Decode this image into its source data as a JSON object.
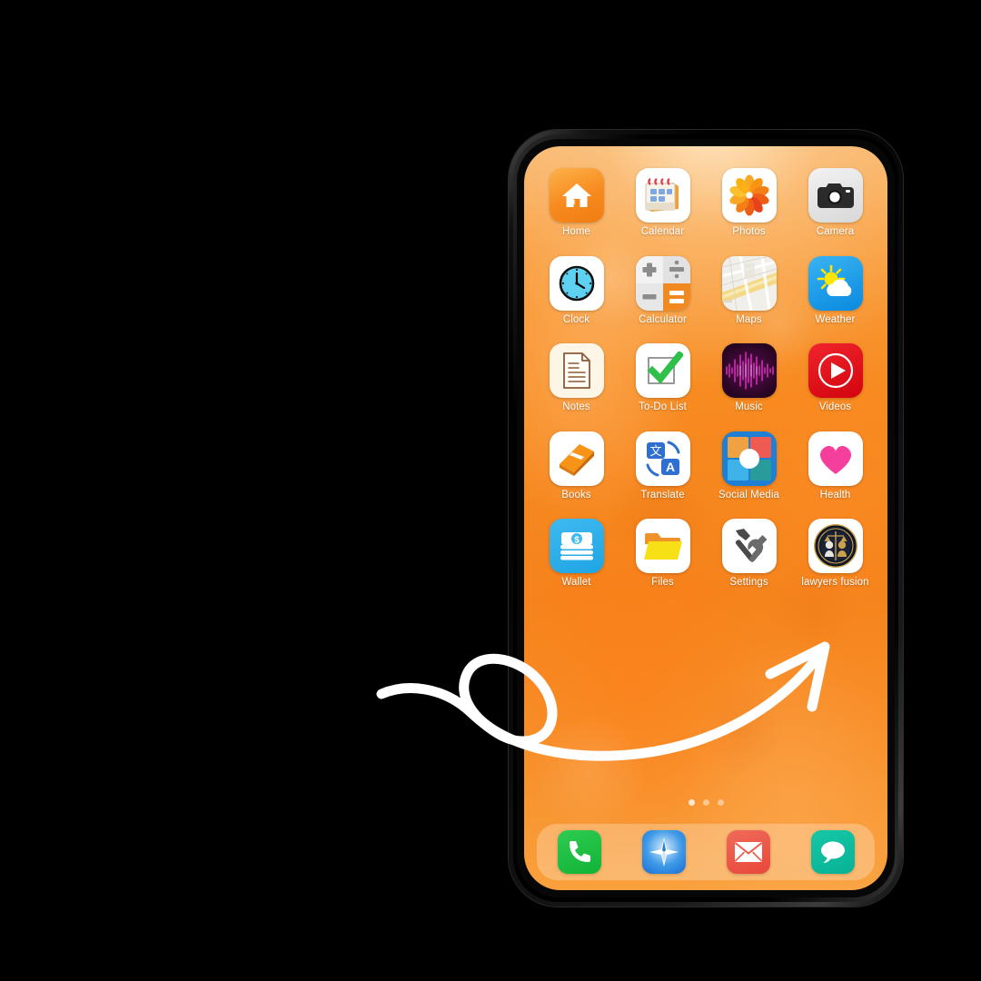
{
  "scene": {
    "background_color": "#000000",
    "device": "smartphone",
    "wallpaper_style": "orange watercolor",
    "wallpaper_colors": [
      "#f9b870",
      "#f78a20",
      "#f6831c"
    ]
  },
  "annotation": {
    "type": "hand-drawn-curved-arrow-with-loop",
    "color": "#ffffff",
    "points_to": "lawyers fusion"
  },
  "homescreen": {
    "apps": [
      {
        "label": "Home",
        "icon": "house-icon"
      },
      {
        "label": "Calendar",
        "icon": "calendar-icon"
      },
      {
        "label": "Photos",
        "icon": "photos-flower-icon"
      },
      {
        "label": "Camera",
        "icon": "camera-icon"
      },
      {
        "label": "Clock",
        "icon": "clock-icon"
      },
      {
        "label": "Calculator",
        "icon": "calculator-icon"
      },
      {
        "label": "Maps",
        "icon": "map-icon"
      },
      {
        "label": "Weather",
        "icon": "sun-cloud-icon"
      },
      {
        "label": "Notes",
        "icon": "document-lines-icon"
      },
      {
        "label": "To-Do List",
        "icon": "checkbox-check-icon"
      },
      {
        "label": "Music",
        "icon": "waveform-icon"
      },
      {
        "label": "Videos",
        "icon": "play-circle-icon"
      },
      {
        "label": "Books",
        "icon": "book-icon"
      },
      {
        "label": "Translate",
        "icon": "translate-icon"
      },
      {
        "label": "Social Media",
        "icon": "four-quadrant-icon"
      },
      {
        "label": "Health",
        "icon": "heart-icon"
      },
      {
        "label": "Wallet",
        "icon": "money-stack-icon"
      },
      {
        "label": "Files",
        "icon": "folder-icon"
      },
      {
        "label": "Settings",
        "icon": "hammer-wrench-icon"
      },
      {
        "label": "lawyers fusion",
        "icon": "lawyers-fusion-badge-icon"
      }
    ],
    "page_indicator": {
      "total": 3,
      "active": 1
    },
    "dock": [
      {
        "label": "Phone",
        "icon": "phone-icon"
      },
      {
        "label": "Safari",
        "icon": "compass-icon"
      },
      {
        "label": "Mail",
        "icon": "envelope-icon"
      },
      {
        "label": "Messages",
        "icon": "chat-bubble-icon"
      }
    ]
  }
}
